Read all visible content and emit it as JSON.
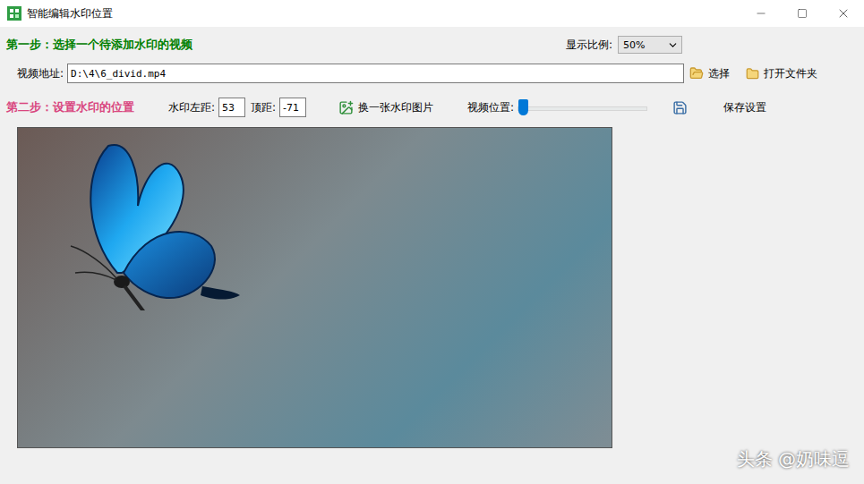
{
  "window": {
    "title": "智能编辑水印位置"
  },
  "step1": {
    "label": "第一步：选择一个待添加水印的视频"
  },
  "scale": {
    "label": "显示比例:",
    "value": "50%"
  },
  "video_path": {
    "label": "视频地址:",
    "value": "D:\\4\\6_divid.mp4"
  },
  "path_buttons": {
    "select": "选择",
    "open_folder": "打开文件夹"
  },
  "step2": {
    "label": "第二步：设置水印的位置"
  },
  "watermark_left": {
    "label": "水印左距:",
    "value": "53"
  },
  "watermark_top": {
    "label": "顶距:",
    "value": "-71"
  },
  "change_image": {
    "label": "换一张水印图片"
  },
  "video_position": {
    "label": "视频位置:",
    "level": 0.0
  },
  "save": {
    "label": "保存设置"
  },
  "overlay_watermark": {
    "text": "头条 @奶味逗"
  }
}
